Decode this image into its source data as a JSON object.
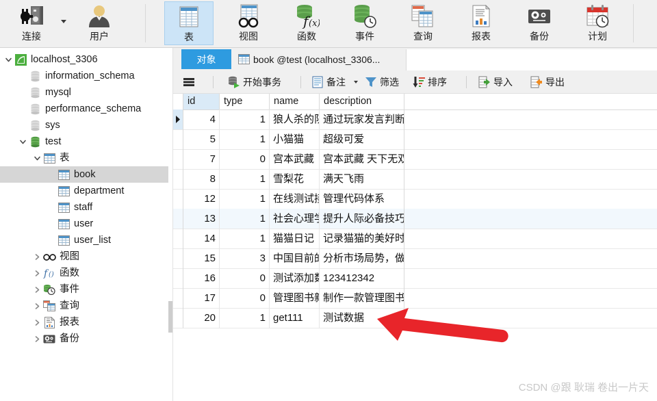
{
  "ribbon": {
    "left_buttons": [
      {
        "label": "连接",
        "icon": "connection-icon",
        "has_caret": true
      },
      {
        "label": "用户",
        "icon": "user-icon",
        "has_caret": false
      }
    ],
    "object_buttons": [
      {
        "label": "表",
        "icon": "table-icon",
        "active": true
      },
      {
        "label": "视图",
        "icon": "view-icon",
        "active": false
      },
      {
        "label": "函数",
        "icon": "function-icon",
        "active": false
      },
      {
        "label": "事件",
        "icon": "event-icon",
        "active": false
      },
      {
        "label": "查询",
        "icon": "query-icon",
        "active": false
      },
      {
        "label": "报表",
        "icon": "report-icon",
        "active": false
      },
      {
        "label": "备份",
        "icon": "backup-icon",
        "active": false
      },
      {
        "label": "计划",
        "icon": "schedule-icon",
        "active": false
      }
    ]
  },
  "sidebar": {
    "items": [
      {
        "label": "localhost_3306",
        "indent": 0,
        "twisty": "down",
        "icon": "connection-green-icon",
        "selected": false
      },
      {
        "label": "information_schema",
        "indent": 1,
        "twisty": "none",
        "icon": "database-gray-icon",
        "selected": false
      },
      {
        "label": "mysql",
        "indent": 1,
        "twisty": "none",
        "icon": "database-gray-icon",
        "selected": false
      },
      {
        "label": "performance_schema",
        "indent": 1,
        "twisty": "none",
        "icon": "database-gray-icon",
        "selected": false
      },
      {
        "label": "sys",
        "indent": 1,
        "twisty": "none",
        "icon": "database-gray-icon",
        "selected": false
      },
      {
        "label": "test",
        "indent": 1,
        "twisty": "down",
        "icon": "database-green-icon",
        "selected": false
      },
      {
        "label": "表",
        "indent": 2,
        "twisty": "down",
        "icon": "table-folder-icon",
        "selected": false
      },
      {
        "label": "book",
        "indent": 3,
        "twisty": "none",
        "icon": "table-icon",
        "selected": true
      },
      {
        "label": "department",
        "indent": 3,
        "twisty": "none",
        "icon": "table-icon",
        "selected": false
      },
      {
        "label": "staff",
        "indent": 3,
        "twisty": "none",
        "icon": "table-icon",
        "selected": false
      },
      {
        "label": "user",
        "indent": 3,
        "twisty": "none",
        "icon": "table-icon",
        "selected": false
      },
      {
        "label": "user_list",
        "indent": 3,
        "twisty": "none",
        "icon": "table-icon",
        "selected": false
      },
      {
        "label": "视图",
        "indent": 2,
        "twisty": "right",
        "icon": "view-icon",
        "selected": false
      },
      {
        "label": "函数",
        "indent": 2,
        "twisty": "right",
        "icon": "function-icon",
        "selected": false
      },
      {
        "label": "事件",
        "indent": 2,
        "twisty": "right",
        "icon": "event-icon",
        "selected": false
      },
      {
        "label": "查询",
        "indent": 2,
        "twisty": "right",
        "icon": "query-icon",
        "selected": false
      },
      {
        "label": "报表",
        "indent": 2,
        "twisty": "right",
        "icon": "report-icon",
        "selected": false
      },
      {
        "label": "备份",
        "indent": 2,
        "twisty": "right",
        "icon": "backup-icon",
        "selected": false
      }
    ]
  },
  "tabs": [
    {
      "label": "对象",
      "icon": null,
      "active": true
    },
    {
      "label": "book @test (localhost_3306...",
      "icon": "table-icon",
      "active": false
    }
  ],
  "toolbar": {
    "menu_icon": "hamburger-icon",
    "items": [
      {
        "label": "开始事务",
        "icon": "begin-transaction-icon",
        "caret": false
      },
      {
        "label": "备注",
        "icon": "note-icon",
        "caret": true
      },
      {
        "label": "筛选",
        "icon": "filter-icon",
        "caret": false
      },
      {
        "label": "排序",
        "icon": "sort-icon",
        "caret": false
      },
      {
        "label": "导入",
        "icon": "import-icon",
        "caret": false
      },
      {
        "label": "导出",
        "icon": "export-icon",
        "caret": false
      }
    ]
  },
  "grid": {
    "columns": [
      "id",
      "type",
      "name",
      "description"
    ],
    "selected_column": "id",
    "current_row_index": 0,
    "highlight_row_index": 5,
    "rows": [
      {
        "id": "4",
        "type": "1",
        "name": "狼人杀的队",
        "description": "通过玩家发言判断"
      },
      {
        "id": "5",
        "type": "1",
        "name": "小猫猫",
        "description": "超级可爱"
      },
      {
        "id": "7",
        "type": "0",
        "name": "宫本武藏",
        "description": "宫本武藏 天下无双"
      },
      {
        "id": "8",
        "type": "1",
        "name": "雪梨花",
        "description": "满天飞雨"
      },
      {
        "id": "12",
        "type": "1",
        "name": "在线测试接",
        "description": "管理代码体系"
      },
      {
        "id": "13",
        "type": "1",
        "name": "社会心理学",
        "description": "提升人际必备技巧"
      },
      {
        "id": "14",
        "type": "1",
        "name": "猫猫日记",
        "description": "记录猫猫的美好时"
      },
      {
        "id": "15",
        "type": "3",
        "name": "中国目前的",
        "description": "分析市场局势，做"
      },
      {
        "id": "16",
        "type": "0",
        "name": "测试添加数",
        "description": "123412342"
      },
      {
        "id": "17",
        "type": "0",
        "name": "管理图书新",
        "description": "制作一款管理图书"
      },
      {
        "id": "20",
        "type": "1",
        "name": "get111",
        "description": "测试数据"
      }
    ]
  },
  "annotation": {
    "shape": "arrow-left",
    "color": "#e8252a"
  },
  "watermark": {
    "text": "CSDN @跟 耿瑞 卷出一片天"
  },
  "colors": {
    "accent_blue": "#2e9be0",
    "ribbon_bg": "#f0f0f0",
    "active_button": "#cce4f7",
    "selection_gray": "#d6d6d6",
    "arrow_red": "#e8252a"
  }
}
